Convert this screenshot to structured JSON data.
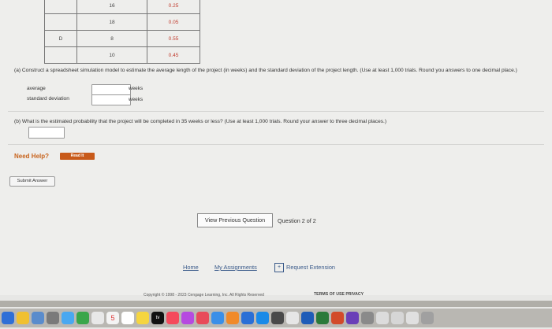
{
  "table": {
    "rows": [
      {
        "activity": "",
        "time": "16",
        "prob": "0.25"
      },
      {
        "activity": "",
        "time": "18",
        "prob": "0.05"
      },
      {
        "activity": "D",
        "time": "8",
        "prob": "0.55"
      },
      {
        "activity": "",
        "time": "10",
        "prob": "0.45"
      }
    ]
  },
  "part_a": {
    "label": "(a)",
    "text": "Construct a spreadsheet simulation model to estimate the average length of the project (in weeks) and the standard deviation of the project length. (Use at least 1,000 trials. Round you answers to one decimal place.)",
    "average_label": "average",
    "average_value": "",
    "average_unit": "weeks",
    "sd_label": "standard deviation",
    "sd_value": "",
    "sd_unit": "weeks"
  },
  "part_b": {
    "label": "(b)",
    "text": "What is the estimated probability that the project will be completed in 35 weeks or less? (Use at least 1,000 trials. Round your answer to three decimal places.)",
    "value": ""
  },
  "need_help": {
    "label": "Need Help?",
    "read_button": "Read It"
  },
  "submit_label": "Submit Answer",
  "navigation": {
    "prev_label": "View Previous Question",
    "position": "Question 2 of 2"
  },
  "footer": {
    "home": "Home",
    "assignments": "My Assignments",
    "extension": "Request Extension",
    "copyright": "Copyright © 1998 - 2023 Cengage Learning, Inc. All Rights Reserved",
    "terms": "TERMS OF USE    PRIVACY"
  },
  "dock": {
    "tv_label": "tv",
    "calendar_day": "5"
  }
}
